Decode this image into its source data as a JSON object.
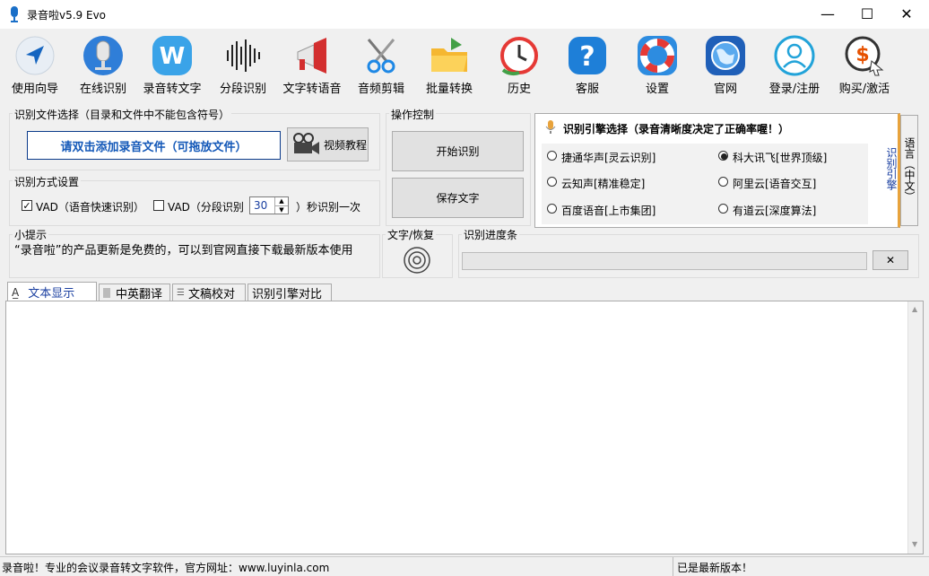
{
  "window": {
    "title": "录音啦v5.9 Evo",
    "minimize": "—",
    "maximize": "☐",
    "close": "✕"
  },
  "toolbar": [
    {
      "id": "wizard",
      "label": "使用向导",
      "icon": "navigation-arrow-icon"
    },
    {
      "id": "online",
      "label": "在线识别",
      "icon": "microphone-icon"
    },
    {
      "id": "rec2text",
      "label": "录音转文字",
      "icon": "w-letter-icon"
    },
    {
      "id": "segment",
      "label": "分段识别",
      "icon": "waveform-icon"
    },
    {
      "id": "tts",
      "label": "文字转语音",
      "icon": "megaphone-icon"
    },
    {
      "id": "cut",
      "label": "音频剪辑",
      "icon": "scissors-icon"
    },
    {
      "id": "batch",
      "label": "批量转换",
      "icon": "folder-icon"
    },
    {
      "id": "history",
      "label": "历史",
      "icon": "history-clock-icon"
    },
    {
      "id": "service",
      "label": "客服",
      "icon": "help-icon"
    },
    {
      "id": "settings",
      "label": "设置",
      "icon": "lifebuoy-icon"
    },
    {
      "id": "website",
      "label": "官网",
      "icon": "globe-icon"
    },
    {
      "id": "login",
      "label": "登录/注册",
      "icon": "user-icon"
    },
    {
      "id": "buy",
      "label": "购买/激活",
      "icon": "dollar-icon"
    }
  ],
  "file_select": {
    "title": "识别文件选择（目录和文件中不能包含符号）",
    "add_label": "请双击添加录音文件（可拖放文件）",
    "video_label": "视频教程"
  },
  "mode": {
    "title": "识别方式设置",
    "vad1_label": "VAD（语音快速识别）",
    "vad1_checked": true,
    "vad2_label": "VAD（分段识别",
    "seconds": "30",
    "seconds_suffix": "）秒识别一次"
  },
  "control": {
    "title": "操作控制",
    "start_label": "开始识别",
    "save_label": "保存文字"
  },
  "engine": {
    "title": "识别引擎选择（录音清晰度决定了正确率喔！）",
    "side_label": "识别引擎",
    "lang_label": "语言（中文）",
    "options": [
      {
        "label": "捷通华声[灵云识别]",
        "selected": false
      },
      {
        "label": "科大讯飞[世界顶级]",
        "selected": true
      },
      {
        "label": "云知声[精准稳定]",
        "selected": false
      },
      {
        "label": "阿里云[语音交互]",
        "selected": false
      },
      {
        "label": "百度语音[上市集团]",
        "selected": false
      },
      {
        "label": "有道云[深度算法]",
        "selected": false
      }
    ]
  },
  "tips": {
    "title": "小提示",
    "text": "“录音啦”的产品更新是免费的，可以到官网直接下载最新版本使用"
  },
  "restore": {
    "title": "文字/恢复"
  },
  "progress": {
    "title": "识别进度条",
    "value": 0,
    "cancel_label": "✕"
  },
  "tabs": [
    {
      "label": "文本显示",
      "icon": "text-a-icon"
    },
    {
      "label": "中英翻译",
      "icon": "document-icon"
    },
    {
      "label": "文稿校对",
      "icon": "list-icon"
    },
    {
      "label": "识别引擎对比",
      "icon": ""
    }
  ],
  "status": {
    "left": "录音啦！专业的会议录音转文字软件，官方网址：www.luyinla.com",
    "right": "已是最新版本！"
  },
  "colors": {
    "accent_blue": "#0a58b7",
    "engine_border": "#e8a33c"
  }
}
